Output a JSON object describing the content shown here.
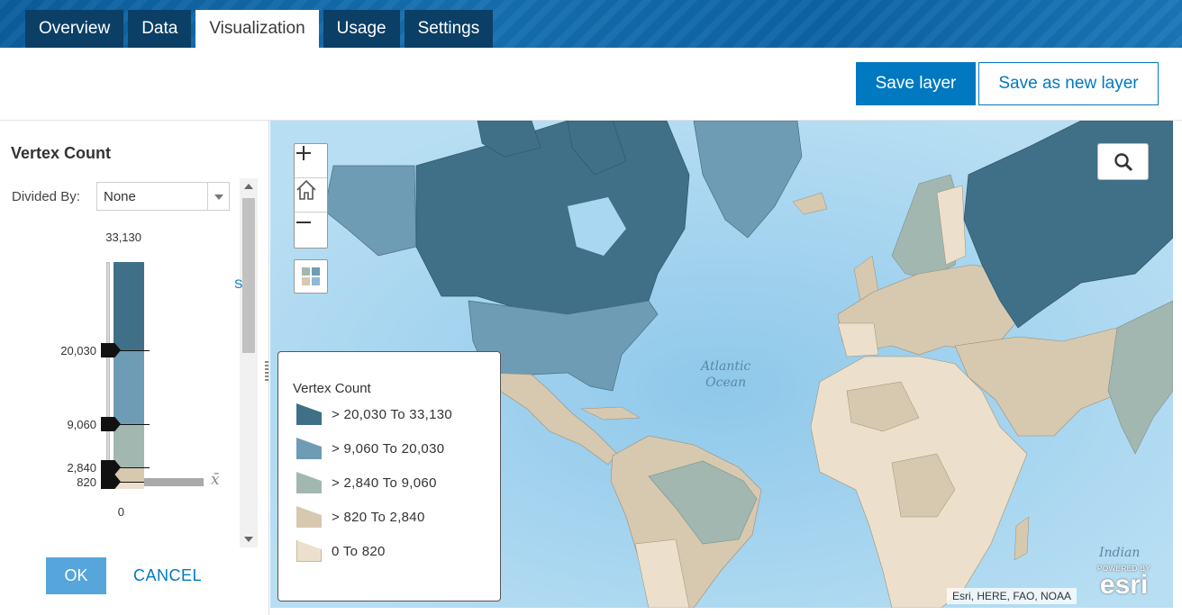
{
  "tabs": [
    {
      "label": "Overview",
      "active": false
    },
    {
      "label": "Data",
      "active": false
    },
    {
      "label": "Visualization",
      "active": true
    },
    {
      "label": "Usage",
      "active": false
    },
    {
      "label": "Settings",
      "active": false
    }
  ],
  "actions": {
    "save_label": "Save layer",
    "save_new_label": "Save as new layer"
  },
  "panel": {
    "title": "Vertex Count",
    "divided_by_label": "Divided By:",
    "divided_by_value": "None",
    "fragment_text": "S",
    "histogram": {
      "max_label": "33,130",
      "break_1": "20,030",
      "break_2": "9,060",
      "break_3": "2,840",
      "break_4": "820",
      "min_label": "0",
      "mean_symbol": "x̄"
    },
    "ok_label": "OK",
    "cancel_label": "CANCEL"
  },
  "legend": {
    "title": "Vertex Count",
    "items": [
      {
        "label": "> 20,030 To 33,130",
        "color": "#3f7088"
      },
      {
        "label": "> 9,060 To 20,030",
        "color": "#6e9cb4"
      },
      {
        "label": "> 2,840 To 9,060",
        "color": "#a2b7b0"
      },
      {
        "label": "> 820 To 2,840",
        "color": "#d6c9b0"
      },
      {
        "label": "0 To 820",
        "color": "#ece0cd"
      }
    ]
  },
  "map": {
    "ocean_atlantic_1": "Atlantic",
    "ocean_atlantic_2": "Ocean",
    "ocean_indian": "Indian",
    "attribution": "Esri, HERE, FAO, NOAA",
    "logo_powered": "POWERED BY",
    "logo_word": "esri"
  },
  "colors": {
    "accent": "#0079c1",
    "class_1": "#3f7088",
    "class_2": "#6e9cb4",
    "class_3": "#a2b7b0",
    "class_4": "#d6c9b0",
    "class_5": "#ece0cd",
    "water": "#a9d6f0"
  }
}
